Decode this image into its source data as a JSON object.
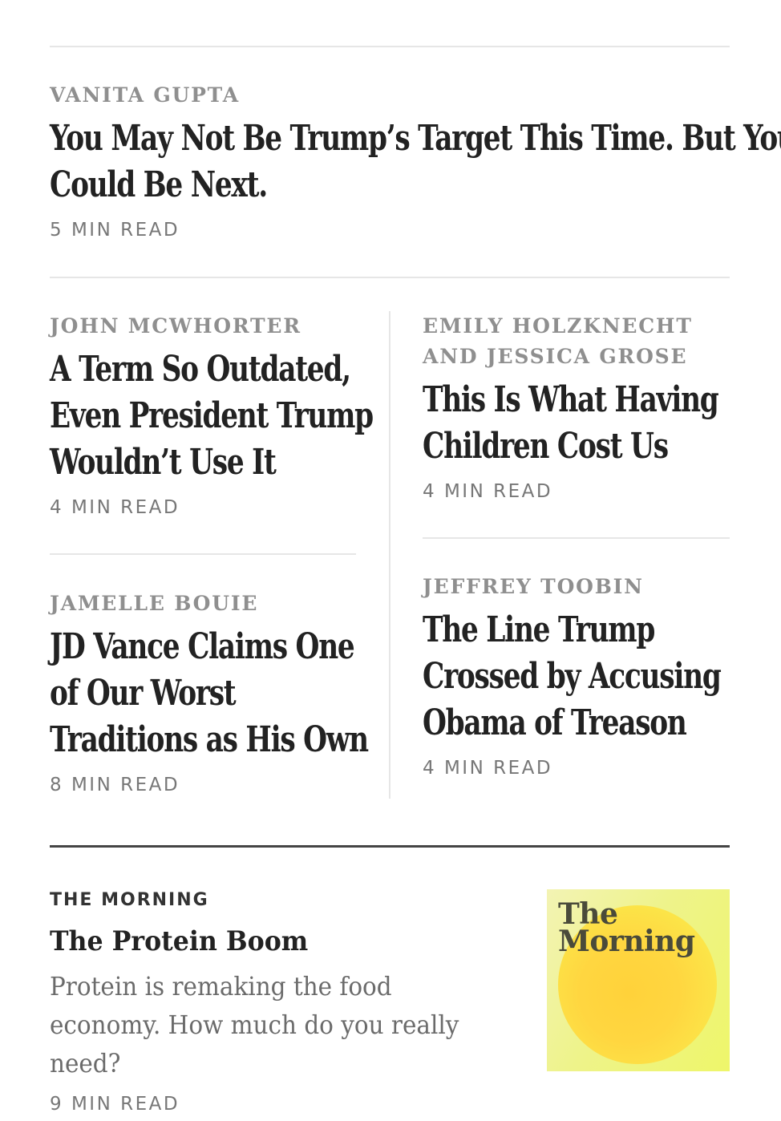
{
  "top_story": {
    "author": "VANITA GUPTA",
    "headline_line1": "You May Not Be Trump’s Target This Time. But You",
    "headline_line2": "Could Be Next.",
    "read_time": "5 MIN READ"
  },
  "grid": {
    "left_top": {
      "author": "JOHN MCWHORTER",
      "headline_lines": [
        "A Term So Outdated,",
        "Even President Trump",
        "Wouldn’t Use It"
      ],
      "read_time": "4 MIN READ"
    },
    "right_top": {
      "author_lines": [
        "EMILY HOLZKNECHT",
        "AND JESSICA GROSE"
      ],
      "headline_lines": [
        "This Is What Having",
        "Children Cost Us"
      ],
      "read_time": "4 MIN READ"
    },
    "left_bottom": {
      "author": "JAMELLE BOUIE",
      "headline_lines": [
        "JD Vance Claims One",
        "of Our Worst",
        "Traditions as His Own"
      ],
      "read_time": "8 MIN READ"
    },
    "right_bottom": {
      "author": "JEFFREY TOOBIN",
      "headline_lines": [
        "The Line Trump",
        "Crossed by Accusing",
        "Obama of Treason"
      ],
      "read_time": "4 MIN READ"
    }
  },
  "morning": {
    "label": "THE MORNING",
    "title": "The Protein Boom",
    "summary": "Protein is remaking the food economy. How much do you really need?",
    "read_time": "9 MIN READ",
    "thumbnail": {
      "logo_line1": "The",
      "logo_line2": "Morning"
    }
  },
  "colors": {
    "headline": "#222222",
    "author": "#8f8f8f",
    "read_time": "#777777",
    "rule": "#e6e6e6",
    "section_rule": "#444444"
  }
}
